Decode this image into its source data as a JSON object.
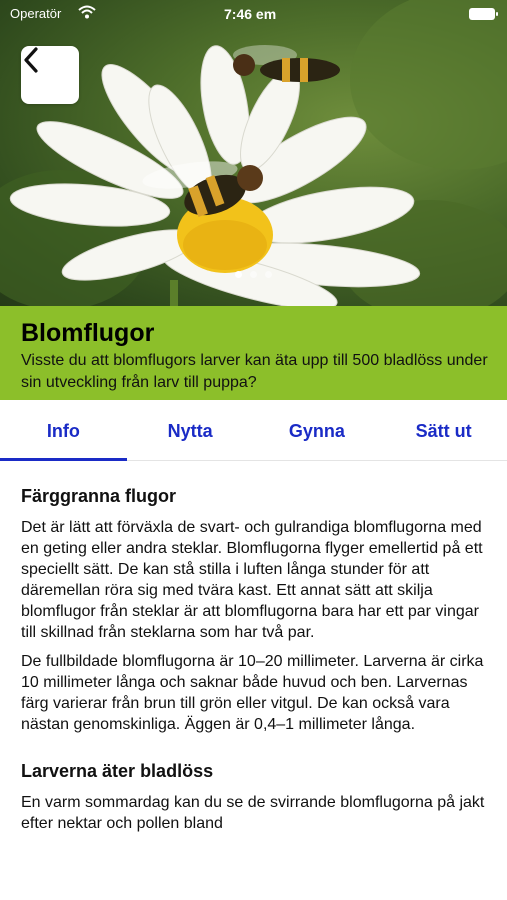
{
  "status_bar": {
    "carrier": "Operatör",
    "time": "7:46 em"
  },
  "hero": {
    "image_subject": "hoverflies on daisy",
    "page_dots": 3,
    "active_dot": 1
  },
  "back_button": {
    "icon": "chevron-left-icon"
  },
  "header": {
    "title": "Blomflugor",
    "subtitle": "Visste du att blomflugors larver kan äta upp till 500 bladlöss under sin utveckling från larv till puppa?",
    "band_color": "#8cbf2a"
  },
  "tabs": [
    {
      "label": "Info",
      "active": true
    },
    {
      "label": "Nytta",
      "active": false
    },
    {
      "label": "Gynna",
      "active": false
    },
    {
      "label": "Sätt ut",
      "active": false
    }
  ],
  "accent_color": "#1a2bc6",
  "content": {
    "section1": {
      "heading": "Färggranna flugor",
      "paragraph1": "Det är lätt att förväxla de svart- och gulrandiga blomflugorna med en geting eller andra steklar. Blomflugorna flyger emellertid på ett speciellt sätt. De kan stå stilla i luften långa stunder för att däremellan röra sig med tvära kast. Ett annat sätt att skilja blomflugor från steklar är att blomflugorna bara har ett par vingar till skillnad från steklarna som har två par.",
      "paragraph2": "De fullbildade blomflugorna är 10–20 millimeter. Larverna är cirka 10 millimeter långa och saknar både huvud och ben. Larvernas färg varierar från brun till grön eller vitgul. De kan också vara nästan genomskinliga. Äggen är 0,4–1 millimeter långa."
    },
    "section2": {
      "heading": "Larverna äter bladlöss",
      "paragraph1": "En varm sommardag kan du se de svirrande blomflugorna på jakt efter nektar och pollen bland"
    }
  }
}
